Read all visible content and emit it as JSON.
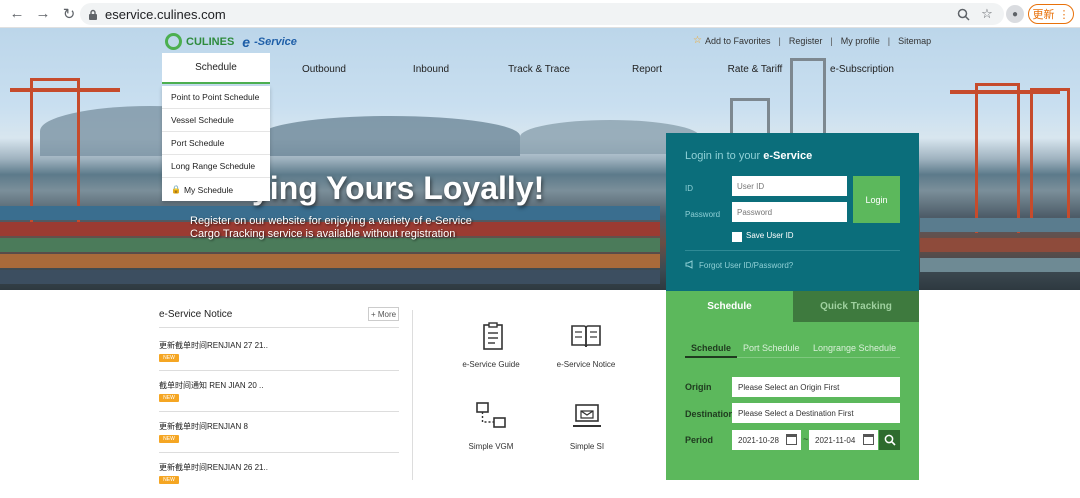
{
  "browser": {
    "url": "eservice.culines.com",
    "update_label": "更新",
    "icons": [
      "back-arrow-icon",
      "forward-arrow-icon",
      "reload-icon",
      "lock-icon",
      "zoom-icon",
      "star-icon",
      "profile-icon",
      "menu-icon"
    ]
  },
  "header": {
    "logo_text": "CULINES",
    "logo_e": "e",
    "logo_service": "-Service",
    "top_links": [
      "Add to Favorites",
      "Register",
      "My profile",
      "Sitemap"
    ]
  },
  "nav": {
    "items": [
      "Schedule",
      "Outbound",
      "Inbound",
      "Track & Trace",
      "Report",
      "Rate & Tariff",
      "e-Subscription"
    ]
  },
  "dropdown": {
    "items": [
      "Point to Point Schedule",
      "Vessel Schedule",
      "Port Schedule",
      "Long Range Schedule",
      "My Schedule"
    ]
  },
  "hero": {
    "title": "ying Yours Loyally!",
    "line1": "Register on our website for enjoying a variety of e-Service",
    "line2": "Cargo Tracking service is available without registration"
  },
  "login": {
    "title_prefix": "Login in to your ",
    "title_bold": "e-Service",
    "id_label": "ID",
    "id_placeholder": "User ID",
    "password_label": "Password",
    "password_placeholder": "Password",
    "login_button": "Login",
    "save_label": "Save User ID",
    "forgot_label": "Forgot User ID/Password?"
  },
  "schedule_panel": {
    "tab_schedule": "Schedule",
    "tab_tracking": "Quick Tracking",
    "sub_tabs": [
      "Schedule",
      "Port Schedule",
      "Longrange Schedule"
    ],
    "origin_label": "Origin",
    "origin_value": "Please Select an Origin First",
    "destination_label": "Destination",
    "destination_value": "Please Select a Destination First",
    "period_label": "Period",
    "date_from": "2021-10-28",
    "date_to": "2021-11-04",
    "tilde": "~"
  },
  "notice": {
    "title": "e-Service Notice",
    "more_label": "+ More",
    "badge": "NEW",
    "items": [
      "更新截单时间RENJIAN 27 21..",
      "截单时间通知 REN JIAN 20 ..",
      "更新截单时间RENJIAN 8",
      "更新截单时间RENJIAN 26 21.."
    ]
  },
  "quick_links": [
    "e-Service Guide",
    "e-Service Notice",
    "Simple VGM",
    "Simple SI"
  ],
  "colors": {
    "login_bg": "#0b6e7b",
    "schedule_green": "#5cb85c",
    "dark_green": "#3e7a3e",
    "accent_orange": "#f5a623"
  }
}
